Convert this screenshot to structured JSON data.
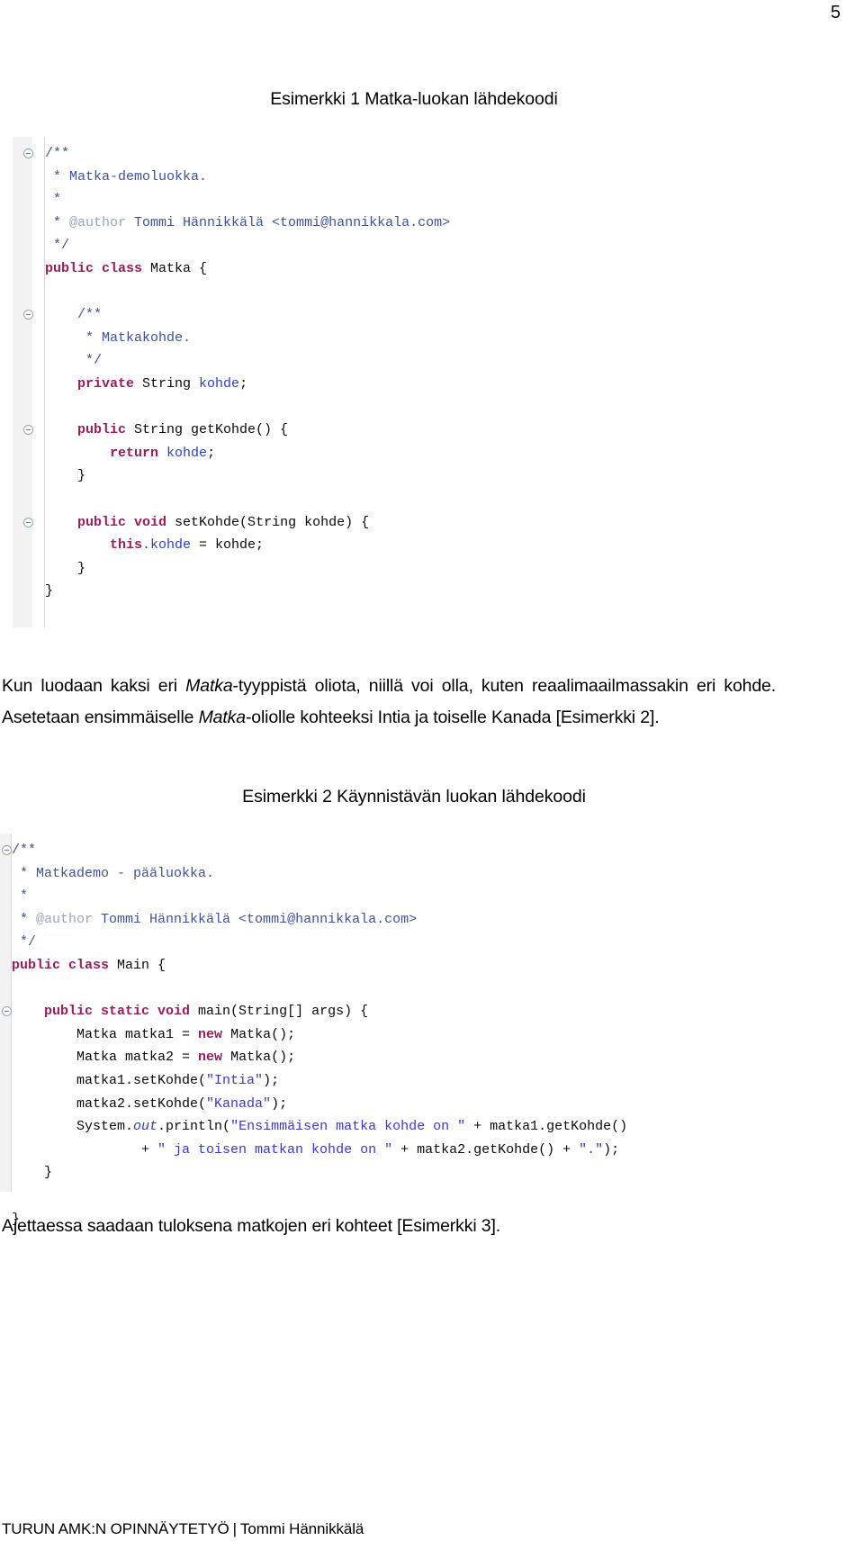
{
  "page": {
    "number": "5",
    "footer_left": "TURUN AMK:N OPINNÄYTETYÖ",
    "footer_separator": "|",
    "footer_right": "Tommi Hännikkälä"
  },
  "captions": {
    "figure1": "Esimerkki 1 Matka-luokan lähdekoodi",
    "figure2": "Esimerkki 2 Käynnistävän luokan lähdekoodi"
  },
  "paragraphs": {
    "p1_a": "Kun luodaan kaksi eri ",
    "p1_em1": "Matka",
    "p1_b": "-tyyppistä oliota, niillä voi olla, kuten reaalimaailmassakin eri kohde. Asetetaan ensimmäiselle ",
    "p1_em2": "Matka",
    "p1_c": "-oliolle kohteeksi Intia ja toiselle Kanada [Esimerkki 2].",
    "p2": "Ajettaessa saadaan tuloksena matkojen eri kohteet [Esimerkki 3]."
  },
  "code1": {
    "lines": [
      {
        "fold": true,
        "tokens": [
          {
            "t": "comment",
            "v": "/**"
          }
        ]
      },
      {
        "fold": false,
        "tokens": [
          {
            "t": "comment",
            "v": " * Matka-demoluokka."
          }
        ]
      },
      {
        "fold": false,
        "tokens": [
          {
            "t": "comment",
            "v": " *"
          }
        ]
      },
      {
        "fold": false,
        "tokens": [
          {
            "t": "comment",
            "v": " * "
          },
          {
            "t": "javadoc-tag",
            "v": "@author"
          },
          {
            "t": "comment",
            "v": " Tommi Hännikkälä <tommi@hannikkala.com>"
          }
        ]
      },
      {
        "fold": false,
        "tokens": [
          {
            "t": "comment",
            "v": " */"
          }
        ]
      },
      {
        "fold": false,
        "tokens": [
          {
            "t": "keyword",
            "v": "public class"
          },
          {
            "t": "plain",
            "v": " Matka {"
          }
        ]
      },
      {
        "fold": false,
        "tokens": [
          {
            "t": "plain",
            "v": ""
          }
        ]
      },
      {
        "fold": true,
        "tokens": [
          {
            "t": "comment",
            "v": "    /**"
          }
        ]
      },
      {
        "fold": false,
        "tokens": [
          {
            "t": "comment",
            "v": "     * Matkakohde."
          }
        ]
      },
      {
        "fold": false,
        "tokens": [
          {
            "t": "comment",
            "v": "     */"
          }
        ]
      },
      {
        "fold": false,
        "tokens": [
          {
            "t": "plain",
            "v": "    "
          },
          {
            "t": "keyword",
            "v": "private"
          },
          {
            "t": "plain",
            "v": " String "
          },
          {
            "t": "field",
            "v": "kohde"
          },
          {
            "t": "plain",
            "v": ";"
          }
        ]
      },
      {
        "fold": false,
        "tokens": [
          {
            "t": "plain",
            "v": ""
          }
        ]
      },
      {
        "fold": true,
        "tokens": [
          {
            "t": "plain",
            "v": "    "
          },
          {
            "t": "keyword",
            "v": "public"
          },
          {
            "t": "plain",
            "v": " String getKohde() {"
          }
        ]
      },
      {
        "fold": false,
        "tokens": [
          {
            "t": "plain",
            "v": "        "
          },
          {
            "t": "keyword",
            "v": "return"
          },
          {
            "t": "plain",
            "v": " "
          },
          {
            "t": "field",
            "v": "kohde"
          },
          {
            "t": "plain",
            "v": ";"
          }
        ]
      },
      {
        "fold": false,
        "tokens": [
          {
            "t": "plain",
            "v": "    }"
          }
        ]
      },
      {
        "fold": false,
        "tokens": [
          {
            "t": "plain",
            "v": ""
          }
        ]
      },
      {
        "fold": true,
        "tokens": [
          {
            "t": "plain",
            "v": "    "
          },
          {
            "t": "keyword",
            "v": "public void"
          },
          {
            "t": "plain",
            "v": " setKohde(String kohde) {"
          }
        ]
      },
      {
        "fold": false,
        "tokens": [
          {
            "t": "plain",
            "v": "        "
          },
          {
            "t": "keyword",
            "v": "this"
          },
          {
            "t": "field",
            "v": ".kohde"
          },
          {
            "t": "plain",
            "v": " = kohde;"
          }
        ]
      },
      {
        "fold": false,
        "tokens": [
          {
            "t": "plain",
            "v": "    }"
          }
        ]
      },
      {
        "fold": false,
        "tokens": [
          {
            "t": "plain",
            "v": "}"
          }
        ]
      }
    ]
  },
  "code2": {
    "lines": [
      {
        "fold": true,
        "tokens": [
          {
            "t": "comment",
            "v": "/**"
          }
        ]
      },
      {
        "fold": false,
        "tokens": [
          {
            "t": "comment",
            "v": " * Matkademo - pääluokka."
          }
        ]
      },
      {
        "fold": false,
        "tokens": [
          {
            "t": "comment",
            "v": " *"
          }
        ]
      },
      {
        "fold": false,
        "tokens": [
          {
            "t": "comment",
            "v": " * "
          },
          {
            "t": "javadoc-tag",
            "v": "@author"
          },
          {
            "t": "comment",
            "v": " Tommi Hännikkälä <tommi@hannikkala.com>"
          }
        ]
      },
      {
        "fold": false,
        "tokens": [
          {
            "t": "comment",
            "v": " */"
          }
        ]
      },
      {
        "fold": false,
        "tokens": [
          {
            "t": "keyword",
            "v": "public class"
          },
          {
            "t": "plain",
            "v": " Main {"
          }
        ]
      },
      {
        "fold": false,
        "tokens": [
          {
            "t": "plain",
            "v": ""
          }
        ]
      },
      {
        "fold": true,
        "tokens": [
          {
            "t": "plain",
            "v": "    "
          },
          {
            "t": "keyword",
            "v": "public static void"
          },
          {
            "t": "plain",
            "v": " main(String[] args) {"
          }
        ]
      },
      {
        "fold": false,
        "tokens": [
          {
            "t": "plain",
            "v": "        Matka matka1 = "
          },
          {
            "t": "keyword",
            "v": "new"
          },
          {
            "t": "plain",
            "v": " Matka();"
          }
        ]
      },
      {
        "fold": false,
        "tokens": [
          {
            "t": "plain",
            "v": "        Matka matka2 = "
          },
          {
            "t": "keyword",
            "v": "new"
          },
          {
            "t": "plain",
            "v": " Matka();"
          }
        ]
      },
      {
        "fold": false,
        "tokens": [
          {
            "t": "plain",
            "v": "        matka1.setKohde("
          },
          {
            "t": "string",
            "v": "\"Intia\""
          },
          {
            "t": "plain",
            "v": ");"
          }
        ]
      },
      {
        "fold": false,
        "tokens": [
          {
            "t": "plain",
            "v": "        matka2.setKohde("
          },
          {
            "t": "string",
            "v": "\"Kanada\""
          },
          {
            "t": "plain",
            "v": ");"
          }
        ]
      },
      {
        "fold": false,
        "tokens": [
          {
            "t": "plain",
            "v": "        System."
          },
          {
            "t": "static",
            "v": "out"
          },
          {
            "t": "plain",
            "v": ".println("
          },
          {
            "t": "string",
            "v": "\"Ensimmäisen matka kohde on \""
          },
          {
            "t": "plain",
            "v": " + matka1.getKohde()"
          }
        ]
      },
      {
        "fold": false,
        "tokens": [
          {
            "t": "plain",
            "v": "                + "
          },
          {
            "t": "string",
            "v": "\" ja toisen matkan kohde on \""
          },
          {
            "t": "plain",
            "v": " + matka2.getKohde() + "
          },
          {
            "t": "string",
            "v": "\".\""
          },
          {
            "t": "plain",
            "v": ");"
          }
        ]
      },
      {
        "fold": false,
        "tokens": [
          {
            "t": "plain",
            "v": "    }"
          }
        ]
      },
      {
        "fold": false,
        "tokens": [
          {
            "t": "plain",
            "v": ""
          }
        ]
      },
      {
        "fold": false,
        "tokens": [
          {
            "t": "plain",
            "v": "}"
          }
        ]
      }
    ]
  }
}
